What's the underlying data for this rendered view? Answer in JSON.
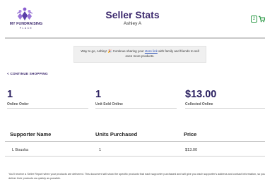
{
  "header": {
    "logo_line1": "MY FUNDRAISING",
    "logo_line2": "PLACE",
    "title": "Seller Stats",
    "seller_name": "Ashley A",
    "cart_count": "2"
  },
  "banner": {
    "text_before": "Way to go, Ashley! 🎉 Continue sharing your ",
    "link_text": "store link",
    "text_after": " with family and friends to sell even more products."
  },
  "nav": {
    "continue_label": "< CONTINUE SHOPPING"
  },
  "stats": [
    {
      "value": "1",
      "label": "Online Order"
    },
    {
      "value": "1",
      "label": "Unit Sold Online"
    },
    {
      "value": "$13.00",
      "label": "Collected Online"
    }
  ],
  "table": {
    "headers": [
      "Supporter Name",
      "Units Purchased",
      "Price"
    ],
    "rows": [
      {
        "name": "L Bouska",
        "units": "1",
        "price": "$13.00"
      }
    ]
  },
  "footer": {
    "text": "You'll receive a Seller Report when your products are delivered. This document will show the specific products that each supporter purchased and will give you each supporter's address and contact information, so you can deliver their products as quickly as possible."
  },
  "colors": {
    "brand_purple": "#3d2a6e",
    "stat_value": "#2b2060",
    "cart_green": "#2e9a48",
    "link_blue": "#2a4fb7"
  }
}
